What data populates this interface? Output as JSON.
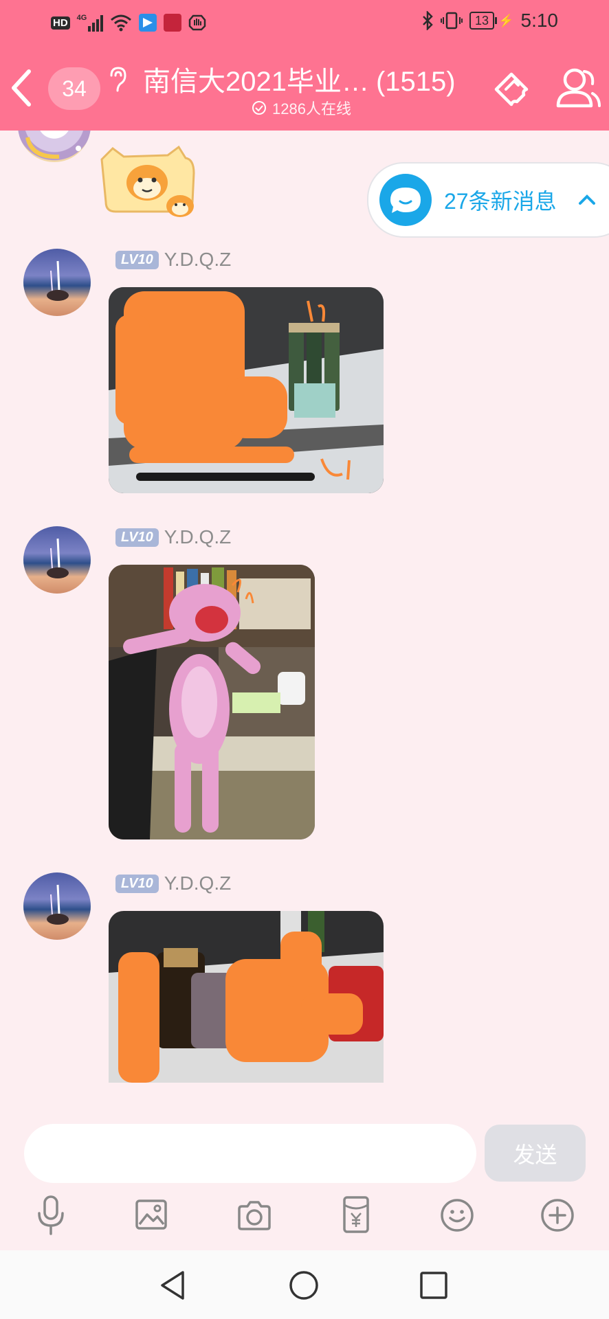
{
  "status_bar": {
    "hd": "HD",
    "network": "4G",
    "battery": "13",
    "time": "5:10"
  },
  "header": {
    "unread_count": "34",
    "group_title": "南信大2021毕业…",
    "member_count": "(1515)",
    "online": "1286人在线"
  },
  "new_messages_pill": {
    "label": "27条新消息"
  },
  "messages": [
    {
      "level": "LV10",
      "username": "Y.D.Q.Z",
      "annotation": ""
    },
    {
      "level": "LV10",
      "username": "Y.D.Q.Z",
      "annotation": ""
    },
    {
      "level": "LV10",
      "username": "Y.D.Q.Z",
      "annotation": ""
    }
  ],
  "composer": {
    "placeholder": "",
    "send_label": "发送"
  },
  "toolbar_icons": [
    "microphone-icon",
    "image-icon",
    "camera-icon",
    "red-packet-icon",
    "emoji-icon",
    "plus-icon"
  ],
  "colors": {
    "header_bg": "#fe7391",
    "chat_bg": "#fdeef1",
    "accent_blue": "#1aa7e8",
    "level_badge": "#a9b6d8"
  }
}
